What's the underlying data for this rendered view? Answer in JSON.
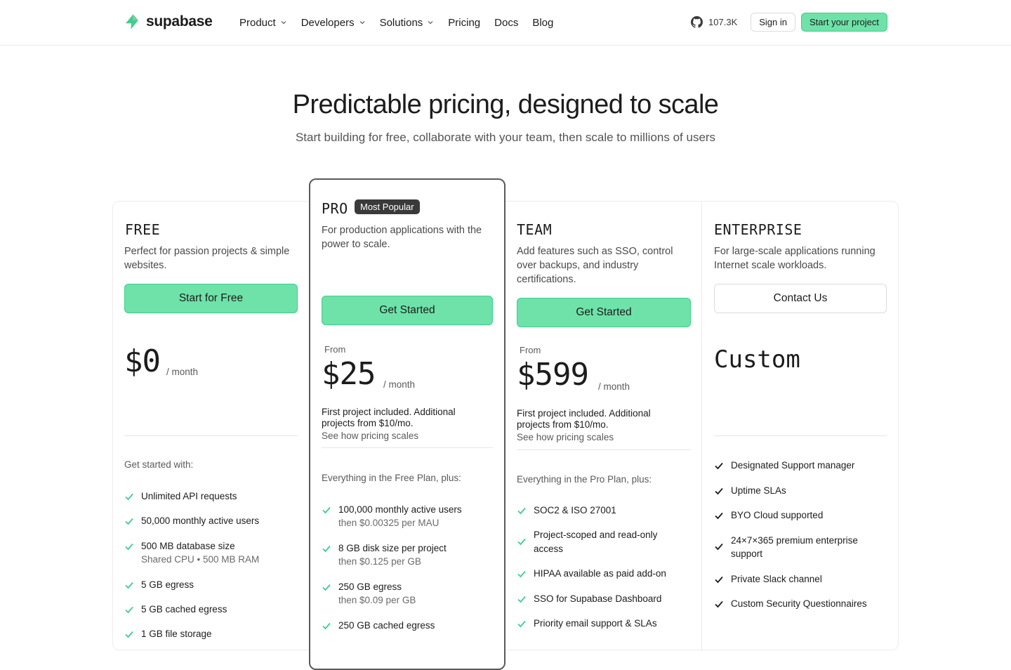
{
  "nav": {
    "logo_text": "supabase",
    "links": [
      {
        "label": "Product",
        "dropdown": true
      },
      {
        "label": "Developers",
        "dropdown": true
      },
      {
        "label": "Solutions",
        "dropdown": true
      },
      {
        "label": "Pricing",
        "dropdown": false
      },
      {
        "label": "Docs",
        "dropdown": false
      },
      {
        "label": "Blog",
        "dropdown": false
      }
    ],
    "github_stars": "107.3K",
    "sign_in": "Sign in",
    "start_project": "Start your project"
  },
  "hero": {
    "title": "Predictable pricing, designed to scale",
    "subtitle": "Start building for free, collaborate with your team, then scale to millions of users"
  },
  "colors": {
    "brand": "#3ecf8e",
    "cta_fill": "#6ee2a9"
  },
  "plans": {
    "free": {
      "name": "FREE",
      "desc": "Perfect for passion projects & simple websites.",
      "cta": "Start for Free",
      "price": "$0",
      "per": "/ month",
      "features_head": "Get started with:",
      "features": [
        {
          "text": "Unlimited API requests",
          "sub": ""
        },
        {
          "text": "50,000 monthly active users",
          "sub": ""
        },
        {
          "text": "500 MB database size",
          "sub": "Shared CPU • 500 MB RAM"
        },
        {
          "text": "5 GB egress",
          "sub": ""
        },
        {
          "text": "5 GB cached egress",
          "sub": ""
        },
        {
          "text": "1 GB file storage",
          "sub": ""
        }
      ]
    },
    "pro": {
      "name": "PRO",
      "badge": "Most Popular",
      "desc": "For production applications with the power to scale.",
      "cta": "Get Started",
      "from": "From",
      "price": "$25",
      "per": "/ month",
      "note": "First project included. Additional projects from $10/mo.",
      "scales": "See how pricing scales",
      "features_head": "Everything in the Free Plan, plus:",
      "features": [
        {
          "text": "100,000 monthly active users",
          "sub": "then $0.00325 per MAU"
        },
        {
          "text": "8 GB disk size per project",
          "sub": "then $0.125 per GB"
        },
        {
          "text": "250 GB egress",
          "sub": "then $0.09 per GB"
        },
        {
          "text": "250 GB cached egress",
          "sub": ""
        }
      ]
    },
    "team": {
      "name": "TEAM",
      "desc": "Add features such as SSO, control over backups, and industry certifications.",
      "cta": "Get Started",
      "from": "From",
      "price": "$599",
      "per": "/ month",
      "note": "First project included. Additional projects from $10/mo.",
      "scales": "See how pricing scales",
      "features_head": "Everything in the Pro Plan, plus:",
      "features": [
        {
          "text": "SOC2 & ISO 27001",
          "sub": ""
        },
        {
          "text": "Project-scoped and read-only access",
          "sub": ""
        },
        {
          "text": "HIPAA available as paid add-on",
          "sub": ""
        },
        {
          "text": "SSO for Supabase Dashboard",
          "sub": ""
        },
        {
          "text": "Priority email support & SLAs",
          "sub": ""
        }
      ]
    },
    "enterprise": {
      "name": "ENTERPRISE",
      "desc": "For large-scale applications running Internet scale workloads.",
      "cta": "Contact Us",
      "price": "Custom",
      "features": [
        {
          "text": "Designated Support manager",
          "sub": ""
        },
        {
          "text": "Uptime SLAs",
          "sub": ""
        },
        {
          "text": "BYO Cloud supported",
          "sub": ""
        },
        {
          "text": "24×7×365 premium enterprise support",
          "sub": ""
        },
        {
          "text": "Private Slack channel",
          "sub": ""
        },
        {
          "text": "Custom Security Questionnaires",
          "sub": ""
        }
      ]
    }
  }
}
